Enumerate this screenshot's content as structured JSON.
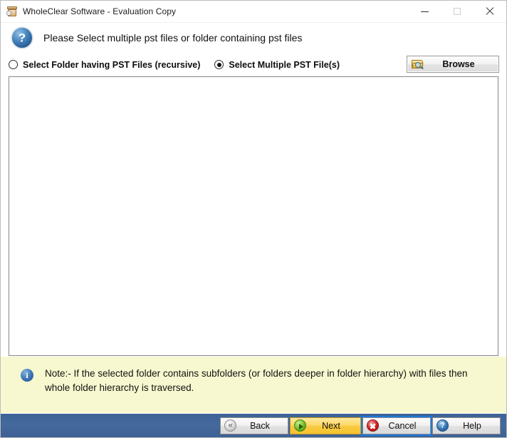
{
  "window": {
    "title": "WholeClear Software - Evaluation Copy",
    "app_icon": "archive-box-icon",
    "controls": {
      "minimize": "minimize-icon",
      "maximize": "maximize-icon",
      "close": "close-icon"
    }
  },
  "header": {
    "icon": "question-mark-icon",
    "instruction": "Please Select multiple pst files or folder containing pst files"
  },
  "options": {
    "folder_option": {
      "label": "Select Folder having PST Files (recursive)",
      "selected": false
    },
    "files_option": {
      "label": "Select Multiple PST File(s)",
      "selected": true
    },
    "browse": {
      "label": "Browse",
      "icon": "folder-search-icon"
    }
  },
  "file_list": {
    "items": [],
    "empty": true
  },
  "note": {
    "icon": "info-icon",
    "text": "Note:- If the selected folder contains subfolders (or folders deeper in folder hierarchy) with files then whole folder hierarchy is traversed."
  },
  "footer": {
    "buttons": [
      {
        "label": "Back",
        "icon": "rewind-circle-icon",
        "focused": false,
        "style": "default"
      },
      {
        "label": "Next",
        "icon": "play-circle-icon",
        "focused": false,
        "style": "primary"
      },
      {
        "label": "Cancel",
        "icon": "cancel-circle-icon",
        "focused": true,
        "style": "default"
      },
      {
        "label": "Help",
        "icon": "help-circle-icon",
        "focused": false,
        "style": "default"
      }
    ]
  },
  "colors": {
    "footer_bar": "#44699d",
    "note_bg": "#f8f8d0",
    "next_button": "#ffd866",
    "focus_ring": "#1b78d8"
  }
}
